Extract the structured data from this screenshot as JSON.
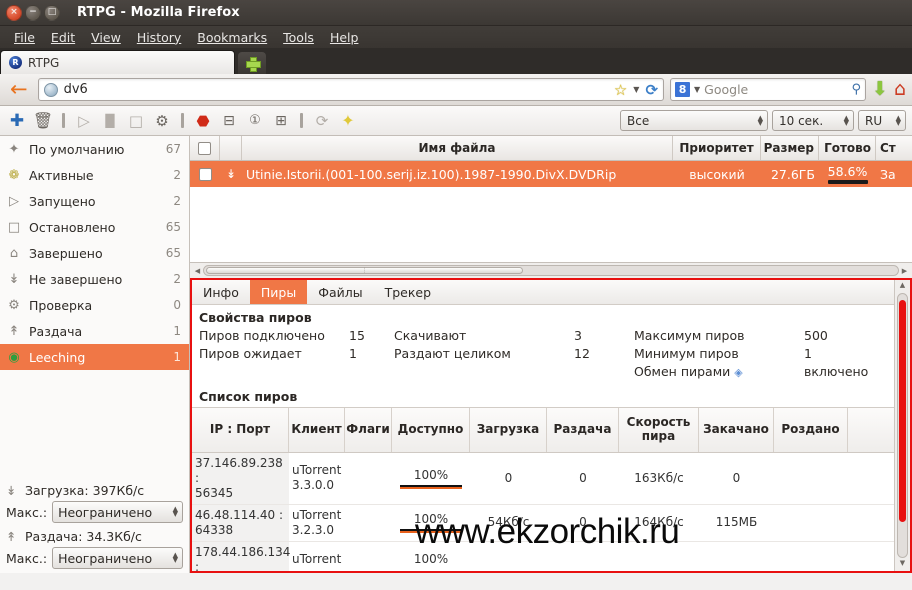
{
  "window": {
    "title": "RTPG - Mozilla Firefox",
    "buttons": {
      "close": "×",
      "minimize": "−",
      "maximize": "□"
    }
  },
  "menubar": {
    "items": [
      {
        "label": "File",
        "accel": "F"
      },
      {
        "label": "Edit",
        "accel": "E"
      },
      {
        "label": "View",
        "accel": "V"
      },
      {
        "label": "History",
        "accel": "s"
      },
      {
        "label": "Bookmarks",
        "accel": "B"
      },
      {
        "label": "Tools",
        "accel": "T"
      },
      {
        "label": "Help",
        "accel": "H"
      }
    ]
  },
  "tabs": {
    "active": "RTPG",
    "favicon_letter": "R",
    "new_tab_label": "+"
  },
  "navbar": {
    "back_icon": "←",
    "url_value": "dv6",
    "star_icon": "☆",
    "reload_icon": "⟳",
    "search_engine": "Google",
    "search_engine_letter": "8",
    "magnify_icon": "⚲",
    "download_icon": "⬇",
    "home_icon": "⌂"
  },
  "apptoolbar": {
    "icons": [
      {
        "name": "add-torrent-icon",
        "glyph": "✚"
      },
      {
        "name": "delete-torrent-icon",
        "glyph": "🗑"
      },
      {
        "name": "start-icon",
        "glyph": "▷"
      },
      {
        "name": "pause-icon",
        "glyph": "▐▌"
      },
      {
        "name": "stop-icon",
        "glyph": "□"
      },
      {
        "name": "settings-icon",
        "glyph": "⚙"
      },
      {
        "name": "record-stop-icon",
        "glyph": "⬣"
      },
      {
        "name": "priority-low-icon",
        "glyph": "⊟"
      },
      {
        "name": "priority-one-icon",
        "glyph": "①"
      },
      {
        "name": "priority-high-icon",
        "glyph": "⊞"
      },
      {
        "name": "refresh-icon",
        "glyph": "⟳"
      },
      {
        "name": "star-icon",
        "glyph": "✦"
      }
    ],
    "filter_select": "Все",
    "interval_select": "10 сек.",
    "lang_select": "RU"
  },
  "sidebar": {
    "categories": [
      {
        "icon": "✦",
        "label": "По умолчанию",
        "count": "67",
        "selected": false
      },
      {
        "icon": "❁",
        "label": "Активные",
        "count": "2",
        "selected": false
      },
      {
        "icon": "▷",
        "label": "Запущено",
        "count": "2",
        "selected": false
      },
      {
        "icon": "□",
        "label": "Остановлено",
        "count": "65",
        "selected": false
      },
      {
        "icon": "⌂",
        "label": "Завершено",
        "count": "65",
        "selected": false
      },
      {
        "icon": "↡",
        "label": "Не завершено",
        "count": "2",
        "selected": false
      },
      {
        "icon": "⚙",
        "label": "Проверка",
        "count": "0",
        "selected": false
      },
      {
        "icon": "↟",
        "label": "Раздача",
        "count": "1",
        "selected": false
      },
      {
        "icon": "◉",
        "label": "Leeching",
        "count": "1",
        "selected": true
      }
    ],
    "download_rate_icon": "↡",
    "download_rate": "Загрузка: 397Кб/с",
    "download_max_label": "Макс.:",
    "download_max_value": "Неограничено",
    "upload_rate_icon": "↟",
    "upload_rate": "Раздача: 34.3Кб/с",
    "upload_max_label": "Макс.:",
    "upload_max_value": "Неограничено"
  },
  "torrent_list": {
    "columns": {
      "filename": "Имя файла",
      "priority": "Приоритет",
      "size": "Размер",
      "done": "Готово",
      "status": "Ст"
    },
    "rows": [
      {
        "icon": "↡",
        "filename": "Utinie.Istorii.(001-100.serij.iz.100).1987-1990.DivX.DVDRip",
        "priority": "высокий",
        "size": "27.6ГБ",
        "done": "58.6%",
        "status": "За",
        "selected": true
      }
    ]
  },
  "details": {
    "tabs": [
      {
        "label": "Инфо",
        "active": false
      },
      {
        "label": "Пиры",
        "active": true
      },
      {
        "label": "Файлы",
        "active": false
      },
      {
        "label": "Трекер",
        "active": false
      }
    ],
    "peer_props_title": "Свойства пиров",
    "props": {
      "connected_label": "Пиров подключено",
      "connected_value": "15",
      "waiting_label": "Пиров ожидает",
      "waiting_value": "1",
      "downloading_label": "Скачивают",
      "downloading_value": "3",
      "seeding_label": "Раздают целиком",
      "seeding_value": "12",
      "max_peers_label": "Максимум пиров",
      "max_peers_value": "500",
      "min_peers_label": "Минимум пиров",
      "min_peers_value": "1",
      "pex_label": "Обмен пирами",
      "pex_icon": "◈",
      "pex_value": "включено"
    },
    "peer_list_title": "Список пиров",
    "peer_columns": [
      "IP : Порт",
      "Клиент",
      "Флаги",
      "Доступно",
      "Загрузка",
      "Раздача",
      "Скорость пира",
      "Закачано",
      "Роздано"
    ],
    "peer_rows": [
      {
        "ip": "37.146.89.238 :",
        "port": "56345",
        "client": "uTorrent",
        "client_ver": "3.3.0.0",
        "flags": "",
        "available": "100%",
        "download": "0",
        "upload": "0",
        "peer_speed": "163Кб/с",
        "downloaded": "0",
        "uploaded": ""
      },
      {
        "ip": "46.48.114.40 :",
        "port": "64338",
        "client": "uTorrent",
        "client_ver": "3.2.3.0",
        "flags": "",
        "available": "100%",
        "download": "54Кб/с",
        "upload": "0",
        "peer_speed": "164Кб/с",
        "downloaded": "115МБ",
        "uploaded": ""
      },
      {
        "ip": "178.44.186.134 :",
        "port": "",
        "client": "uTorrent",
        "client_ver": "",
        "flags": "",
        "available": "100%",
        "download": "",
        "upload": "",
        "peer_speed": "",
        "downloaded": "",
        "uploaded": ""
      }
    ]
  },
  "watermark": "www.ekzorchik.ru",
  "colors": {
    "accent_orange": "#f07746",
    "highlight_red": "#e81010",
    "titlebar_dark": "#3c3834"
  }
}
